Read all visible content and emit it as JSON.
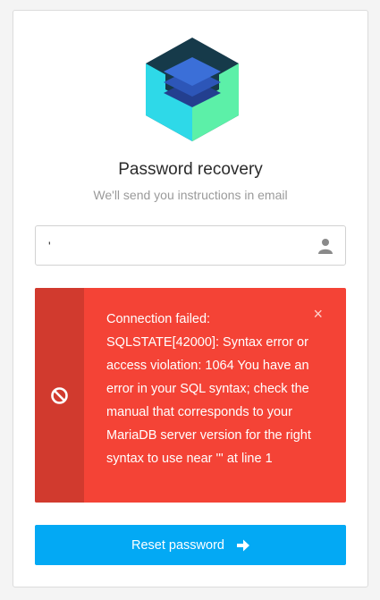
{
  "form": {
    "title": "Password recovery",
    "subtitle": "We'll send you instructions in email",
    "email_value": "'",
    "submit_label": "Reset password"
  },
  "alert": {
    "message": "Connection failed: SQLSTATE[42000]: Syntax error or access violation: 1064 You have an error in your SQL syntax; check the manual that corresponds to your MariaDB server version for the right syntax to use near ''' at line 1",
    "close_symbol": "×"
  },
  "icons": {
    "logo": "hexagon-layers-logo",
    "field": "user-icon",
    "alert": "ban-icon",
    "button": "arrow-right-icon"
  },
  "colors": {
    "accent": "#03a9f4",
    "error": "#f44336",
    "error_dark": "#d13a2e",
    "logo_dark": "#163a4a",
    "logo_green": "#5cf0a8",
    "logo_cyan": "#2ed9e8",
    "logo_blue": "#3b6fd8"
  }
}
